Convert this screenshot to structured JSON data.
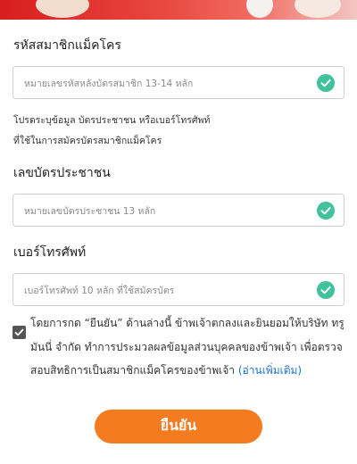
{
  "form": {
    "member_code": {
      "label": "รหัสสมาชิกแม็คโคร",
      "placeholder": "หมายเลขรหัสหลังบัตรสมาชิก 13-14 หลัก",
      "valid_icon": "check-circle-icon"
    },
    "notice": {
      "line1": "โปรดระบุข้อมูล บัตรประชาชน หรือเบอร์โทรศัพท์",
      "line2": "ที่ใช้ในการสมัครบัตรสมาชิกแม็คโคร"
    },
    "id_card": {
      "label": "เลขบัตรประชาชน",
      "placeholder": "หมายเลขบัตรประชาชน 13 หลัก",
      "valid_icon": "check-circle-icon"
    },
    "phone": {
      "label": "เบอร์โทรศัพท์",
      "placeholder": "เบอร์โทรศัพท์ 10 หลัก ที่ใช้สมัครบัตร",
      "valid_icon": "check-circle-icon"
    },
    "consent": {
      "checked": true,
      "text": "โดยการกด “ยืนยัน” ด้านล่างนี้ ข้าพเจ้าตกลงและยินยอมให้บริษัท ทรูมันนี่ จำกัด ทำการประมวลผลข้อมูลส่วนบุคคลของข้าพเจ้า เพื่อตรวจสอบสิทธิการเป็นสมาชิกแม็คโครของข้าพเจ้า ",
      "read_more": "(อ่านเพิ่มเติม)"
    },
    "submit_label": "ยืนยัน"
  },
  "colors": {
    "accent_orange": "#f47b20",
    "valid_green": "#42c29a",
    "link_blue": "#1a73c9",
    "banner_red": "#d81e1e"
  }
}
